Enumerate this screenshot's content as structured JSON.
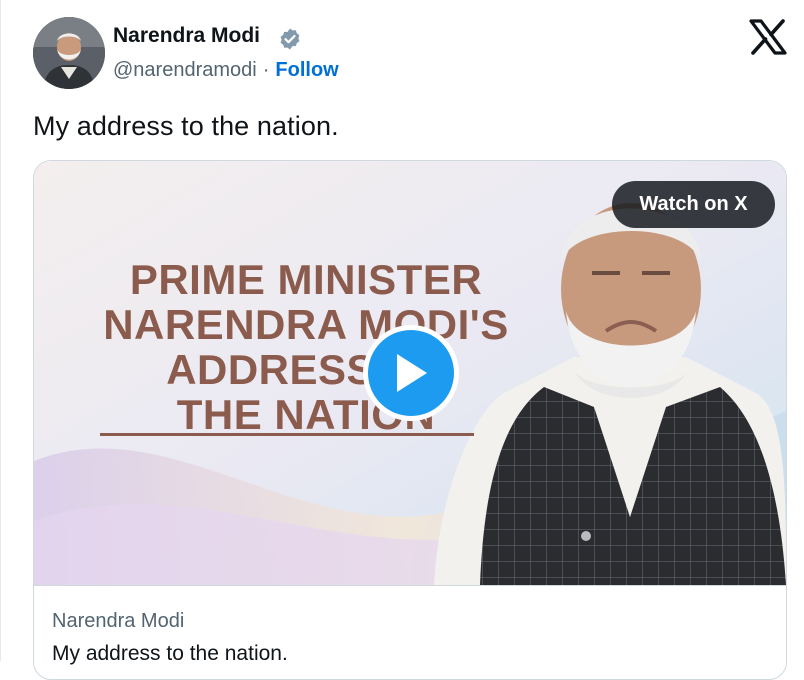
{
  "author": {
    "name": "Narendra Modi",
    "handle": "@narendramodi",
    "separator": "·",
    "follow_label": "Follow"
  },
  "tweet": {
    "text": "My address to the nation."
  },
  "media": {
    "headline_lines": [
      "PRIME MINISTER",
      "NARENDRA MODI'S",
      "ADDRESS TO",
      "THE NATION"
    ],
    "watch_label": "Watch on X"
  },
  "card": {
    "source": "Narendra Modi",
    "title": "My address to the nation."
  },
  "colors": {
    "accent": "#1d9bf0",
    "follow": "#006fd6",
    "headline": "#8b5c4d",
    "verified": "#829aab"
  },
  "icons": {
    "verified": "verified-badge-icon",
    "platform": "x-logo-icon",
    "play": "play-icon"
  }
}
